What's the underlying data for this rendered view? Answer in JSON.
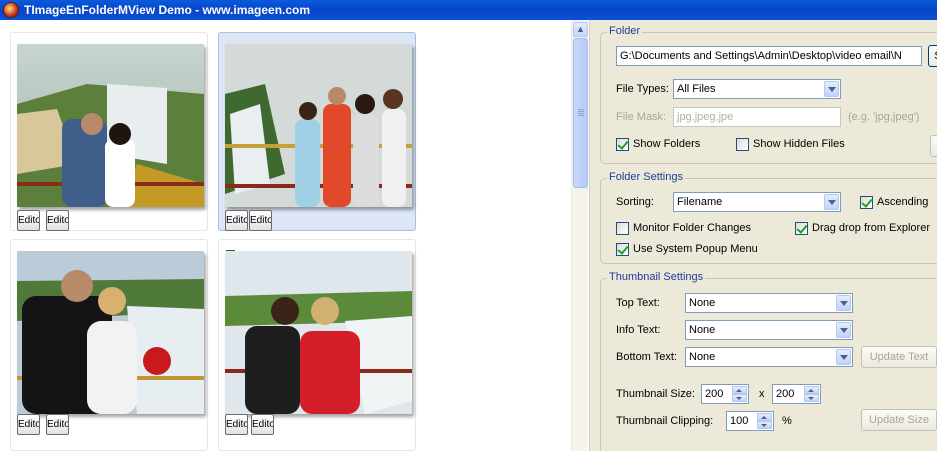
{
  "window": {
    "title": "TImageEnFolderMView Demo - www.imageen.com"
  },
  "thumbnails": [
    {
      "editor1": "Editor",
      "editor2": "Editor",
      "selected": false
    },
    {
      "editor1": "Editor",
      "editor2": "Editor",
      "selected": true
    },
    {
      "editor1": "Editor",
      "editor2": "Editor",
      "selected": false
    },
    {
      "editor1": "Editor",
      "editor2": "Editor",
      "selected": false
    }
  ],
  "folder": {
    "title": "Folder",
    "path": "G:\\Documents and Settings\\Admin\\Desktop\\video email\\N",
    "browse_label": "S",
    "file_types_label": "File Types:",
    "file_types_value": "All Files",
    "file_mask_label": "File Mask:",
    "file_mask_value": "jpg,jpeg,jpe",
    "file_mask_hint": "(e.g. 'jpg,jpeg')",
    "show_folders_label": "Show Folders",
    "show_folders_checked": true,
    "show_hidden_label": "Show Hidden Files",
    "show_hidden_checked": false
  },
  "folder_settings": {
    "title": "Folder Settings",
    "sorting_label": "Sorting:",
    "sorting_value": "Filename",
    "ascending_label": "Ascending",
    "ascending_checked": true,
    "monitor_label": "Monitor Folder Changes",
    "monitor_checked": false,
    "dragdrop_label": "Drag drop from Explorer",
    "dragdrop_checked": true,
    "popup_label": "Use System Popup Menu",
    "popup_checked": true
  },
  "thumbnail_settings": {
    "title": "Thumbnail Settings",
    "top_text_label": "Top Text:",
    "top_text_value": "None",
    "info_text_label": "Info Text:",
    "info_text_value": "None",
    "bottom_text_label": "Bottom Text:",
    "bottom_text_value": "None",
    "update_text_label": "Update Text",
    "size_label": "Thumbnail Size:",
    "width_value": "200",
    "x_label": "x",
    "height_value": "200",
    "clipping_label": "Thumbnail Clipping:",
    "clipping_value": "100",
    "percent_label": "%",
    "update_size_label": "Update Size"
  },
  "colors": {
    "titlebar": "#0a5bde",
    "panel": "#ece9d8",
    "group_title": "#1f3c9a",
    "selection": "#dce6f4"
  }
}
